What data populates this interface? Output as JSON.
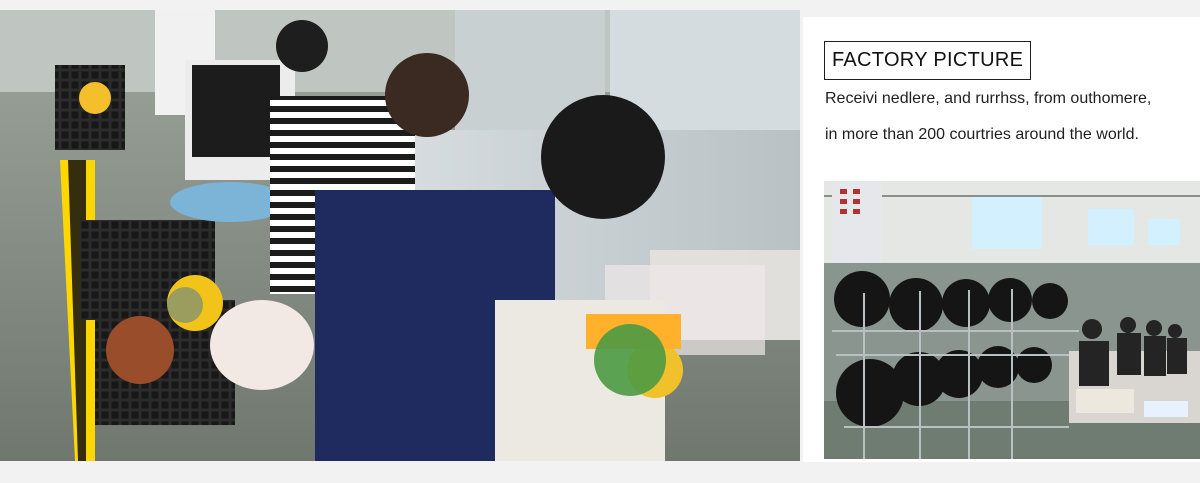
{
  "sidebar_panel": {
    "title": "FACTORY PICTURE",
    "description_line1": "Receivi nedlere, and rurrhss, from outhomere,",
    "description_line2": "in more than 200 courtries around the world."
  },
  "colors": {
    "background": "#f2f2f2",
    "panel_background": "#ffffff",
    "text": "#1f1f1f",
    "border": "#1f1f1f"
  },
  "icons": {
    "main_photo": "factory-workers-photo",
    "secondary_photo": "factory-production-line-photo"
  }
}
